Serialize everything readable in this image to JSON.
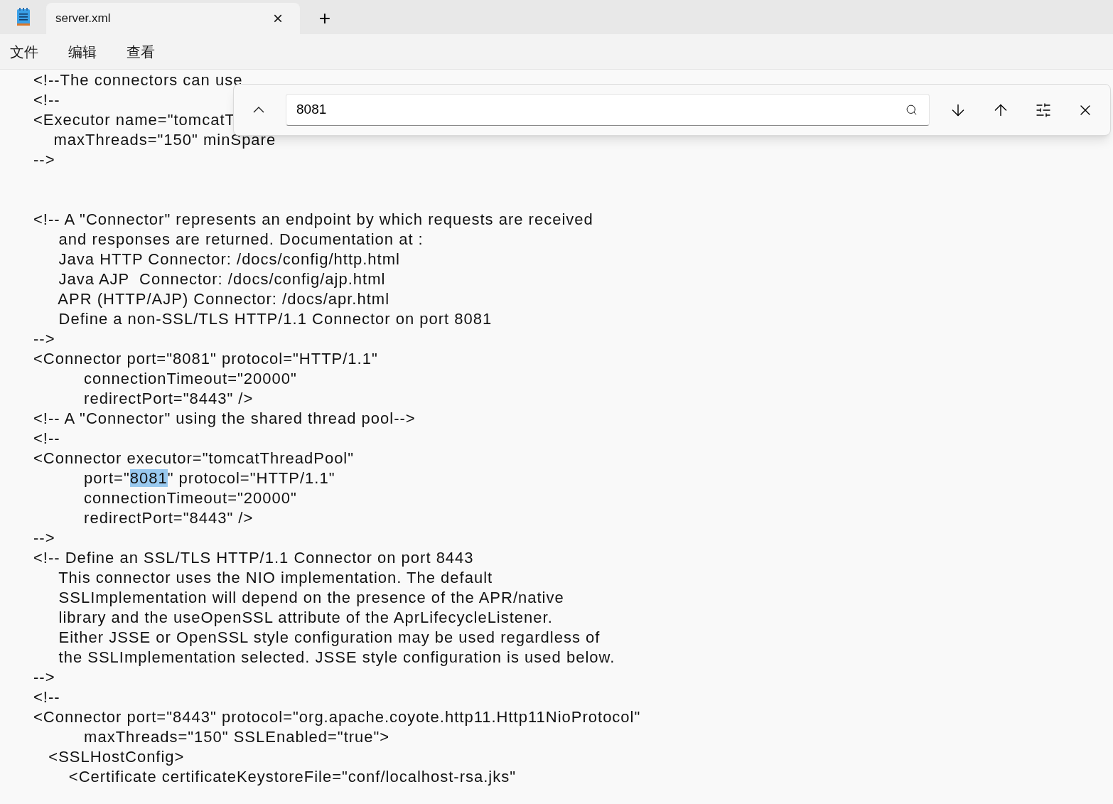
{
  "tabs": [
    {
      "label": "server.xml",
      "selected": true,
      "close": "×"
    }
  ],
  "new_tab": "+",
  "menu": [
    "文件",
    "编辑",
    "查看"
  ],
  "find_bar": {
    "value": "8081"
  },
  "lines": [
    {
      "kind": "code",
      "segments": [
        {
          "text": "<!--The connectors can use",
          "selected": false
        }
      ]
    },
    {
      "kind": "code",
      "segments": [
        {
          "text": "<!--",
          "selected": false
        }
      ]
    },
    {
      "kind": "code",
      "segments": [
        {
          "text": "<Executor name=\"tomcatT",
          "selected": false
        }
      ]
    },
    {
      "kind": "code",
      "segments": [
        {
          "text": "    maxThreads=\"150\" minSpare",
          "selected": false
        }
      ]
    },
    {
      "kind": "code",
      "segments": [
        {
          "text": "-->",
          "selected": false
        }
      ]
    },
    {
      "kind": "blank"
    },
    {
      "kind": "blank"
    },
    {
      "kind": "code",
      "segments": [
        {
          "text": "<!-- A \"Connector\" represents an endpoint by which requests are received",
          "selected": false
        }
      ]
    },
    {
      "kind": "code",
      "segments": [
        {
          "text": "     and responses are returned. Documentation at :",
          "selected": false
        }
      ]
    },
    {
      "kind": "code",
      "segments": [
        {
          "text": "     Java HTTP Connector: /docs/config/http.html",
          "selected": false
        }
      ]
    },
    {
      "kind": "code",
      "segments": [
        {
          "text": "     Java AJP  Connector: /docs/config/ajp.html",
          "selected": false
        }
      ]
    },
    {
      "kind": "code",
      "segments": [
        {
          "text": "     APR (HTTP/AJP) Connector: /docs/apr.html",
          "selected": false
        }
      ]
    },
    {
      "kind": "code",
      "segments": [
        {
          "text": "     Define a non-SSL/TLS HTTP/1.1 Connector on port 8081",
          "selected": false
        }
      ]
    },
    {
      "kind": "code",
      "segments": [
        {
          "text": "-->",
          "selected": false
        }
      ]
    },
    {
      "kind": "code",
      "segments": [
        {
          "text": "<Connector port=\"8081\" protocol=\"HTTP/1.1\"",
          "selected": false
        }
      ]
    },
    {
      "kind": "code",
      "segments": [
        {
          "text": "          connectionTimeout=\"20000\"",
          "selected": false
        }
      ]
    },
    {
      "kind": "code",
      "segments": [
        {
          "text": "          redirectPort=\"8443\" />",
          "selected": false
        }
      ]
    },
    {
      "kind": "code",
      "segments": [
        {
          "text": "<!-- A \"Connector\" using the shared thread pool-->",
          "selected": false
        }
      ]
    },
    {
      "kind": "code",
      "segments": [
        {
          "text": "<!--",
          "selected": false
        }
      ]
    },
    {
      "kind": "code",
      "segments": [
        {
          "text": "<Connector executor=\"tomcatThreadPool\"",
          "selected": false
        }
      ]
    },
    {
      "kind": "code",
      "segments": [
        {
          "text": "          port=\"",
          "selected": false
        },
        {
          "text": "8081",
          "selected": true
        },
        {
          "text": "\" protocol=\"HTTP/1.1\"",
          "selected": false
        }
      ]
    },
    {
      "kind": "code",
      "segments": [
        {
          "text": "          connectionTimeout=\"20000\"",
          "selected": false
        }
      ]
    },
    {
      "kind": "code",
      "segments": [
        {
          "text": "          redirectPort=\"8443\" />",
          "selected": false
        }
      ]
    },
    {
      "kind": "code",
      "segments": [
        {
          "text": "-->",
          "selected": false
        }
      ]
    },
    {
      "kind": "code",
      "segments": [
        {
          "text": "<!-- Define an SSL/TLS HTTP/1.1 Connector on port 8443",
          "selected": false
        }
      ]
    },
    {
      "kind": "code",
      "segments": [
        {
          "text": "     This connector uses the NIO implementation. The default",
          "selected": false
        }
      ]
    },
    {
      "kind": "code",
      "segments": [
        {
          "text": "     SSLImplementation will depend on the presence of the APR/native",
          "selected": false
        }
      ]
    },
    {
      "kind": "code",
      "segments": [
        {
          "text": "     library and the useOpenSSL attribute of the AprLifecycleListener.",
          "selected": false
        }
      ]
    },
    {
      "kind": "code",
      "segments": [
        {
          "text": "     Either JSSE or OpenSSL style configuration may be used regardless of",
          "selected": false
        }
      ]
    },
    {
      "kind": "code",
      "segments": [
        {
          "text": "     the SSLImplementation selected. JSSE style configuration is used below.",
          "selected": false
        }
      ]
    },
    {
      "kind": "code",
      "segments": [
        {
          "text": "-->",
          "selected": false
        }
      ]
    },
    {
      "kind": "code",
      "segments": [
        {
          "text": "<!--",
          "selected": false
        }
      ]
    },
    {
      "kind": "code",
      "segments": [
        {
          "text": "<Connector port=\"8443\" protocol=\"org.apache.coyote.http11.Http11NioProtocol\"",
          "selected": false
        }
      ]
    },
    {
      "kind": "code",
      "segments": [
        {
          "text": "          maxThreads=\"150\" SSLEnabled=\"true\">",
          "selected": false
        }
      ]
    },
    {
      "kind": "code",
      "segments": [
        {
          "text": "   <SSLHostConfig>",
          "selected": false
        }
      ]
    },
    {
      "kind": "code",
      "segments": [
        {
          "text": "       <Certificate certificateKeystoreFile=\"conf/localhost-rsa.jks\"",
          "selected": false
        }
      ]
    }
  ]
}
